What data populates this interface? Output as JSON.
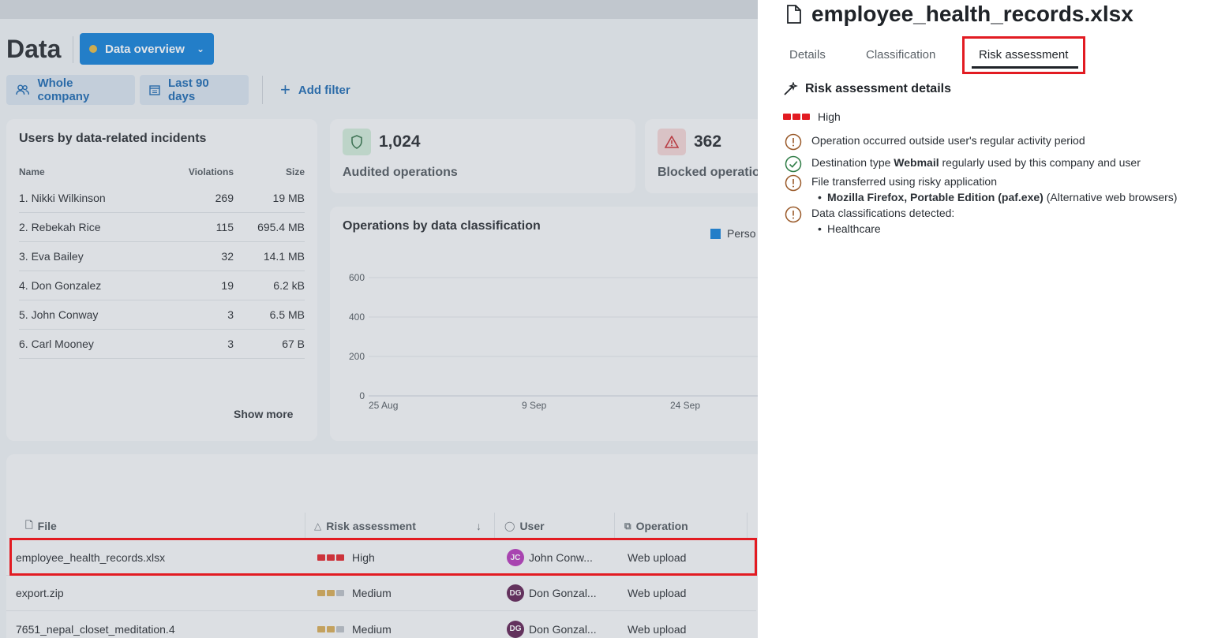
{
  "page": {
    "title": "Data",
    "view_button": "Data overview",
    "filters": [
      "Whole company",
      "Last 90 days"
    ],
    "add_filter": "Add filter"
  },
  "users_card": {
    "title": "Users by data-related incidents",
    "headers": {
      "name": "Name",
      "violations": "Violations",
      "size": "Size"
    },
    "rows": [
      {
        "name": "1. Nikki Wilkinson",
        "violations": "269",
        "size": "19 MB"
      },
      {
        "name": "2. Rebekah Rice",
        "violations": "115",
        "size": "695.4 MB"
      },
      {
        "name": "3. Eva Bailey",
        "violations": "32",
        "size": "14.1 MB"
      },
      {
        "name": "4. Don Gonzalez",
        "violations": "19",
        "size": "6.2 kB"
      },
      {
        "name": "5. John Conway",
        "violations": "3",
        "size": "6.5 MB"
      },
      {
        "name": "6. Carl Mooney",
        "violations": "3",
        "size": "67 B"
      }
    ],
    "show_more": "Show more"
  },
  "kpis": [
    {
      "value": "1,024",
      "label": "Audited operations",
      "icon": "shield-icon",
      "color": "#cfe9d6"
    },
    {
      "value": "362",
      "label": "Blocked operatio",
      "icon": "warning-icon",
      "color": "#f3d3d3"
    }
  ],
  "chart_card": {
    "title": "Operations by data classification",
    "legend": "Perso",
    "y_ticks": [
      "600",
      "400",
      "200",
      "0"
    ],
    "x_ticks": [
      "25 Aug",
      "9 Sep",
      "24 Sep"
    ]
  },
  "table": {
    "headers": {
      "file": "File",
      "risk": "Risk assessment",
      "user": "User",
      "operation": "Operation"
    },
    "rows": [
      {
        "file": "employee_health_records.xlsx",
        "risk": "High",
        "risk_level": 3,
        "user_initials": "JC",
        "user": "John Conw...",
        "avatar_color": "#b431b8",
        "operation": "Web upload"
      },
      {
        "file": "export.zip",
        "risk": "Medium",
        "risk_level": 2,
        "user_initials": "DG",
        "user": "Don Gonzal...",
        "avatar_color": "#5b1a4e",
        "operation": "Web upload"
      },
      {
        "file": "7651_nepal_closet_meditation.4",
        "risk": "Medium",
        "risk_level": 2,
        "user_initials": "DG",
        "user": "Don Gonzal...",
        "avatar_color": "#5b1a4e",
        "operation": "Web upload"
      }
    ]
  },
  "panel": {
    "file_name": "employee_health_records.xlsx",
    "tabs": [
      "Details",
      "Classification",
      "Risk assessment"
    ],
    "active_tab": "Risk assessment",
    "section_title": "Risk assessment details",
    "level": "High",
    "findings": {
      "f1": "Operation occurred outside user's regular activity period",
      "f2_pre": "Destination type ",
      "f2_bold": "Webmail",
      "f2_post": " regularly used by this company and user",
      "f3": "File transferred using risky application",
      "f3_item_bold": "Mozilla Firefox, Portable Edition (paf.exe)",
      "f3_item_post": " (Alternative web browsers)",
      "f4": "Data classifications detected:",
      "f4_item": "Healthcare"
    }
  },
  "colors": {
    "accent": "#0a7bd6",
    "high": "#e21b22",
    "medium": "#d7a84f",
    "highlight": "#e21b22"
  }
}
